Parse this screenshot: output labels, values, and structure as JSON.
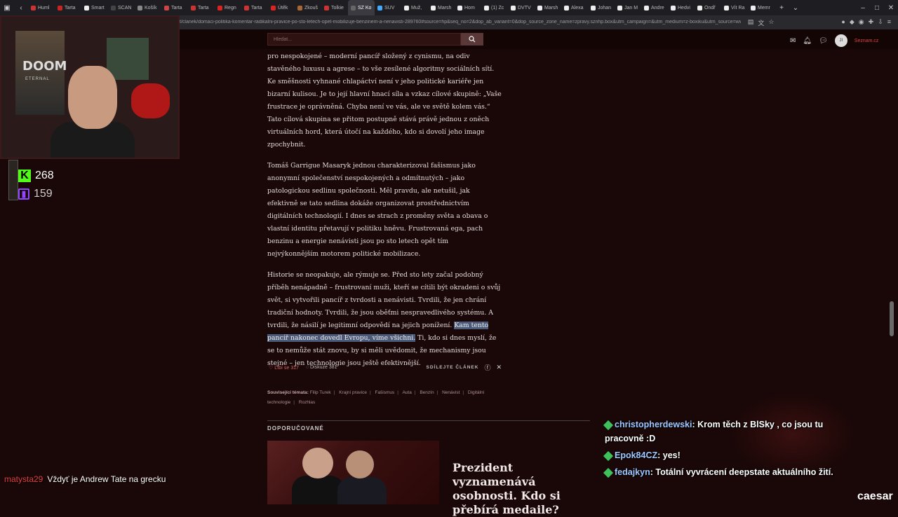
{
  "browser": {
    "tabs": [
      "Huml",
      "Tarta",
      "Smart",
      "SCAN",
      "Košík",
      "Tarta",
      "Tarta",
      "Regn",
      "Tarta",
      "Útěk",
      "Zkouš",
      "Tolkie",
      "SZ Ko",
      "SUV",
      "Muž,",
      "Marsh",
      "Hom",
      "(1) Zc",
      "DVTV",
      "Marsh",
      "Alexa",
      "Johan",
      "Jan M",
      "Andre",
      "Hedvi",
      "Ondř",
      "Vít Ra",
      "Memr"
    ],
    "active_tab_index": 12,
    "url": "t/clanek/domaci-politika-komentar-radikalni-pravice-po-sto-letech-opet-mobilizuje-benzinem-a-nenavisti-289760#source=hp&seq_no=2&dop_ab_variant=0&dop_source_zone_name=zpravy.sznhp.box&utm_campaign=&utm_medium=z-boxiku&utm_source=ww"
  },
  "site": {
    "search_placeholder": "Hledat...",
    "avatar_initials": "JI",
    "brand": "Seznam.cz"
  },
  "article": {
    "p1": "pro nespokojené – moderní pancíř složený z cynismu, na odiv stavěného luxusu a agrese – to vše zesílené algoritmy sociálních sítí. Ke směšnosti vyhnané chlapáctví není v jeho politické kariéře jen bizarní kulisou. Je to její hlavní hnací síla a vzkaz cílové skupině: „Vaše frustrace je oprávněná. Chyba není ve vás, ale ve světě kolem vás.“ Tato cílová skupina se přitom postupně stává právě jednou z oněch virtuálních hord, která útočí na každého, kdo si dovolí jeho image zpochybnit.",
    "p2": "Tomáš Garrigue Masaryk jednou charakterizoval fašismus jako anonymní společenství nespokojených a odmítnutých – jako patologickou sedlinu společnosti. Měl pravdu, ale netušil, jak efektivně se tato sedlina dokáže organizovat prostřednictvím digitálních technologií. I dnes se strach z proměny světa a obava o vlastní identitu přetavují v politiku hněvu. Frustrovaná ega, pach benzinu a energie nenávisti jsou po sto letech opět tím nejvýkonnějším motorem politické mobilizace.",
    "p3_before": "Historie se neopakuje, ale rýmuje se. Před sto lety začal podobný příběh nenápadně – frustrovaní muži, kteří se cítili být okradeni o svůj svět, si vytvořili pancíř z tvrdosti a nenávisti. Tvrdili, že jen chrání tradiční hodnoty. Tvrdili, že jsou oběťmi nespravedlivého systému. A tvrdili, že násilí je legitimní odpovědí na jejich ponížení. ",
    "p3_highlight": "Kam tento pancíř nakonec dovedl Evropu, víme všichni.",
    "p3_after": " Ti, kdo si dnes myslí, že se to nemůže stát znovu, by si měli uvědomit, že mechanismy jsou stejné – jen technologie jsou ještě efektivnější.",
    "likes": "Líbí se 317",
    "discussion": "Diskuze 381",
    "share_label": "SDÍLEJTE ČLÁNEK",
    "related_label": "Související témata:",
    "related": [
      "Filip Turek",
      "Krajní pravice",
      "Fašismus",
      "Auta",
      "Benzín",
      "Nenávist",
      "Digitální technologie",
      "Rozhlas"
    ],
    "recommended_label": "DOPORUČOVANÉ",
    "recommended_title": "Prezident vyznamenává osobnosti. Kdo si přebírá medaile?"
  },
  "stream": {
    "kick_viewers": "268",
    "twitch_viewers": "159",
    "webcam_title": "DOOM",
    "webcam_subtitle": "ETERNAL",
    "chat": [
      {
        "user": "christopherdewski",
        "text": "Krom těch z BlSky , co jsou tu pracovně :D"
      },
      {
        "user": "Epok84CZ",
        "text": "yes!"
      },
      {
        "user": "fedajkyn",
        "text": "Totální vyvrácení deepstate aktuálního žití."
      }
    ],
    "left_chat": {
      "user": "matysta29",
      "text": "Vždyť je Andrew Tate na grecku"
    },
    "channel_tag": "caesar"
  },
  "colors": {
    "background": "#1a0707",
    "highlight": "#4a5a78",
    "kick": "#53fc18",
    "twitch": "#9146ff"
  }
}
